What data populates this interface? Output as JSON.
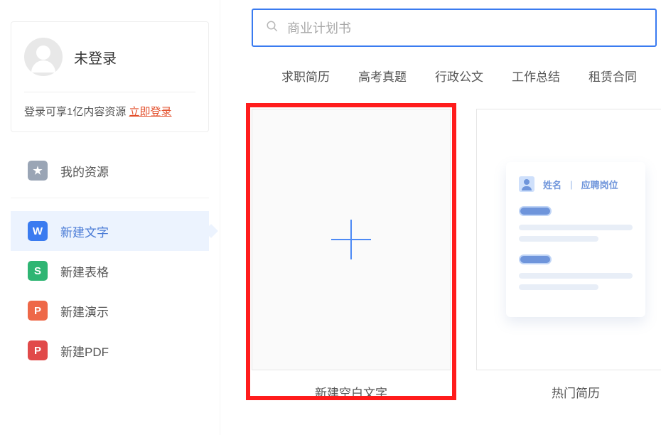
{
  "sidebar": {
    "login_status": "未登录",
    "login_hint": "登录可享1亿内容资源 ",
    "login_link": "立即登录",
    "items": [
      {
        "id": "my-resources",
        "label": "我的资源",
        "icon": "star"
      },
      {
        "id": "new-word",
        "label": "新建文字",
        "icon": "W"
      },
      {
        "id": "new-sheet",
        "label": "新建表格",
        "icon": "S"
      },
      {
        "id": "new-slide",
        "label": "新建演示",
        "icon": "P"
      },
      {
        "id": "new-pdf",
        "label": "新建PDF",
        "icon": "P"
      }
    ]
  },
  "search": {
    "placeholder": "商业计划书"
  },
  "quick_tags": [
    "求职简历",
    "高考真题",
    "行政公文",
    "工作总结",
    "租赁合同"
  ],
  "cards": {
    "blank": {
      "label": "新建空白文字"
    },
    "resume": {
      "label": "热门简历",
      "header_name": "姓名",
      "header_sep": "|",
      "header_pos": "应聘岗位"
    }
  }
}
